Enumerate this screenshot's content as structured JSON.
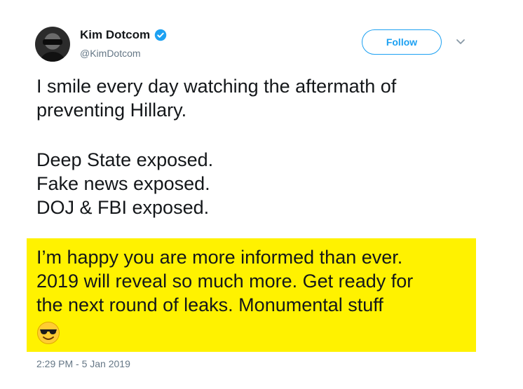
{
  "author": {
    "display_name": "Kim Dotcom",
    "handle": "@KimDotcom",
    "verified": true
  },
  "actions": {
    "follow_label": "Follow"
  },
  "tweet": {
    "paragraph1": [
      "I smile every day watching the aftermath of",
      "preventing Hillary."
    ],
    "paragraph2": [
      "Deep State exposed.",
      "Fake news exposed.",
      "DOJ & FBI exposed."
    ],
    "highlighted": [
      "I’m happy you are more informed than ever.",
      "2019 will reveal so much more. Get ready for",
      "the next round of leaks. Monumental stuff"
    ],
    "emoji": "smiling-face-with-sunglasses",
    "timestamp": "2:29 PM - 5 Jan 2019"
  },
  "colors": {
    "accent": "#1da1f2",
    "highlight": "#fff200",
    "muted_text": "#657786"
  }
}
